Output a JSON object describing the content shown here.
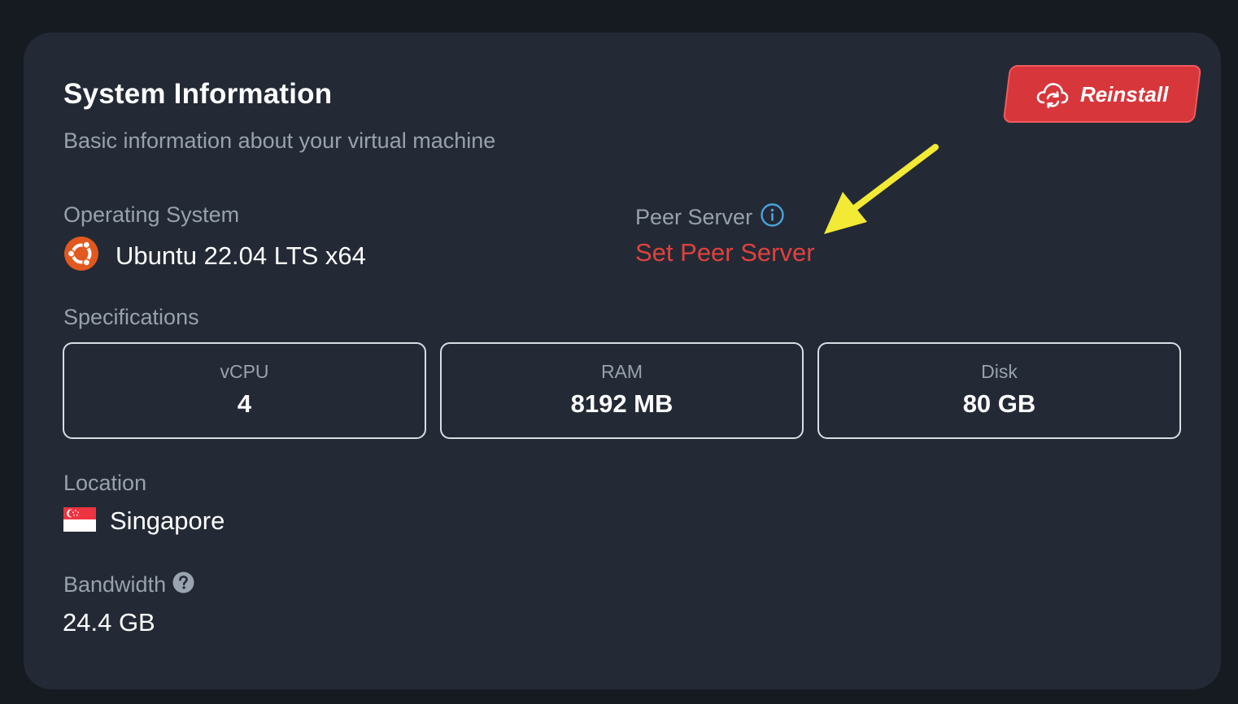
{
  "header": {
    "title": "System Information",
    "subtitle": "Basic information about your virtual machine",
    "reinstall_label": "Reinstall"
  },
  "os": {
    "label": "Operating System",
    "value": "Ubuntu 22.04 LTS x64",
    "icon": "ubuntu-logo-icon"
  },
  "peer": {
    "label": "Peer Server",
    "action_label": "Set Peer Server",
    "icon": "info-icon"
  },
  "specifications": {
    "label": "Specifications",
    "items": [
      {
        "label": "vCPU",
        "value": "4"
      },
      {
        "label": "RAM",
        "value": "8192 MB"
      },
      {
        "label": "Disk",
        "value": "80 GB"
      }
    ]
  },
  "location": {
    "label": "Location",
    "value": "Singapore",
    "icon": "singapore-flag-icon"
  },
  "bandwidth": {
    "label": "Bandwidth",
    "value": "24.4 GB",
    "icon": "help-icon"
  },
  "colors": {
    "background": "#161a21",
    "card": "#232a35",
    "accent_red": "#d7363b",
    "link_red": "#e0413f",
    "muted_text": "#98a1ae",
    "info_blue": "#4aa3df",
    "annotation_arrow": "#f2ea35"
  }
}
